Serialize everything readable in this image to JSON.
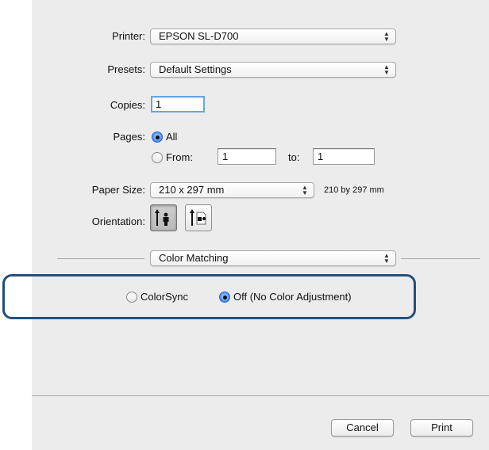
{
  "printer": {
    "label": "Printer:",
    "value": "EPSON SL-D700"
  },
  "presets": {
    "label": "Presets:",
    "value": "Default Settings"
  },
  "copies": {
    "label": "Copies:",
    "value": "1"
  },
  "pages": {
    "label": "Pages:",
    "all_label": "All",
    "from_label": "From:",
    "from_value": "1",
    "to_label": "to:",
    "to_value": "1",
    "selected": "All"
  },
  "paper_size": {
    "label": "Paper Size:",
    "value": "210 x 297 mm",
    "description": "210 by 297 mm"
  },
  "orientation": {
    "label": "Orientation:",
    "selected": "portrait",
    "options": [
      "portrait-icon",
      "landscape-icon"
    ]
  },
  "section": {
    "value": "Color Matching"
  },
  "color_matching": {
    "options": [
      {
        "label": "ColorSync",
        "selected": false
      },
      {
        "label": "Off (No Color Adjustment)",
        "selected": true
      }
    ]
  },
  "buttons": {
    "cancel": "Cancel",
    "print": "Print"
  },
  "colors": {
    "highlight_border": "#244f7c",
    "panel_bg": "#ececec",
    "focus_ring": "#6aa3e8"
  }
}
